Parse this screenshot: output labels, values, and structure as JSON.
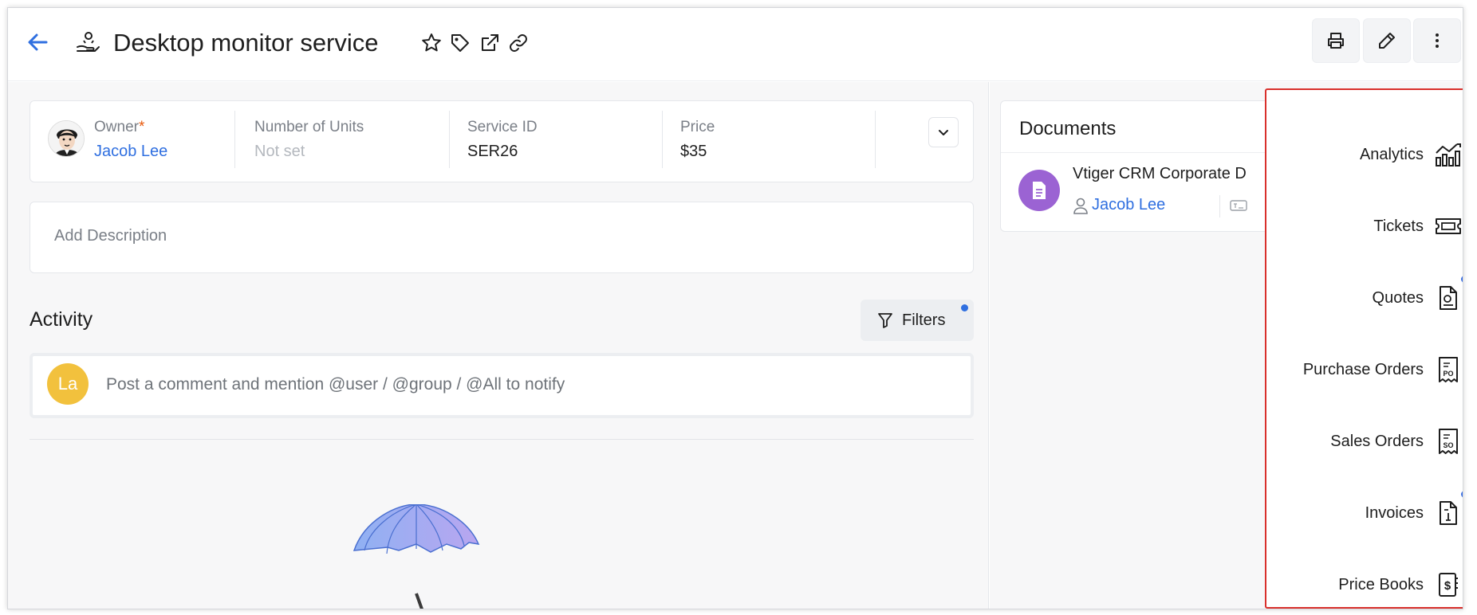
{
  "header": {
    "title": "Desktop monitor service"
  },
  "summary": {
    "owner_label": "Owner",
    "owner_required": "*",
    "owner_value": "Jacob Lee",
    "units_label": "Number of Units",
    "units_value": "Not set",
    "service_id_label": "Service ID",
    "service_id_value": "SER26",
    "price_label": "Price",
    "price_value": "$35"
  },
  "description": {
    "placeholder": "Add Description"
  },
  "activity": {
    "title": "Activity",
    "filters_label": "Filters",
    "comment_avatar": "La",
    "comment_placeholder": "Post a comment and mention @user / @group / @All to notify"
  },
  "documents": {
    "title": "Documents",
    "doc_name": "Vtiger CRM Corporate D",
    "doc_owner": "Jacob Lee"
  },
  "menu": {
    "items": [
      {
        "label": "Analytics",
        "icon": "analytics-icon"
      },
      {
        "label": "Tickets",
        "icon": "ticket-icon"
      },
      {
        "label": "Quotes",
        "icon": "quote-icon"
      },
      {
        "label": "Purchase Orders",
        "icon": "purchase-order-icon"
      },
      {
        "label": "Sales Orders",
        "icon": "sales-order-icon"
      },
      {
        "label": "Invoices",
        "icon": "invoice-icon"
      },
      {
        "label": "Price Books",
        "icon": "price-book-icon"
      }
    ]
  },
  "colors": {
    "accent": "#2f6fe0",
    "highlight_border": "#d9302c",
    "avatar_yellow": "#f2c13d",
    "doc_purple": "#9b63d3"
  }
}
